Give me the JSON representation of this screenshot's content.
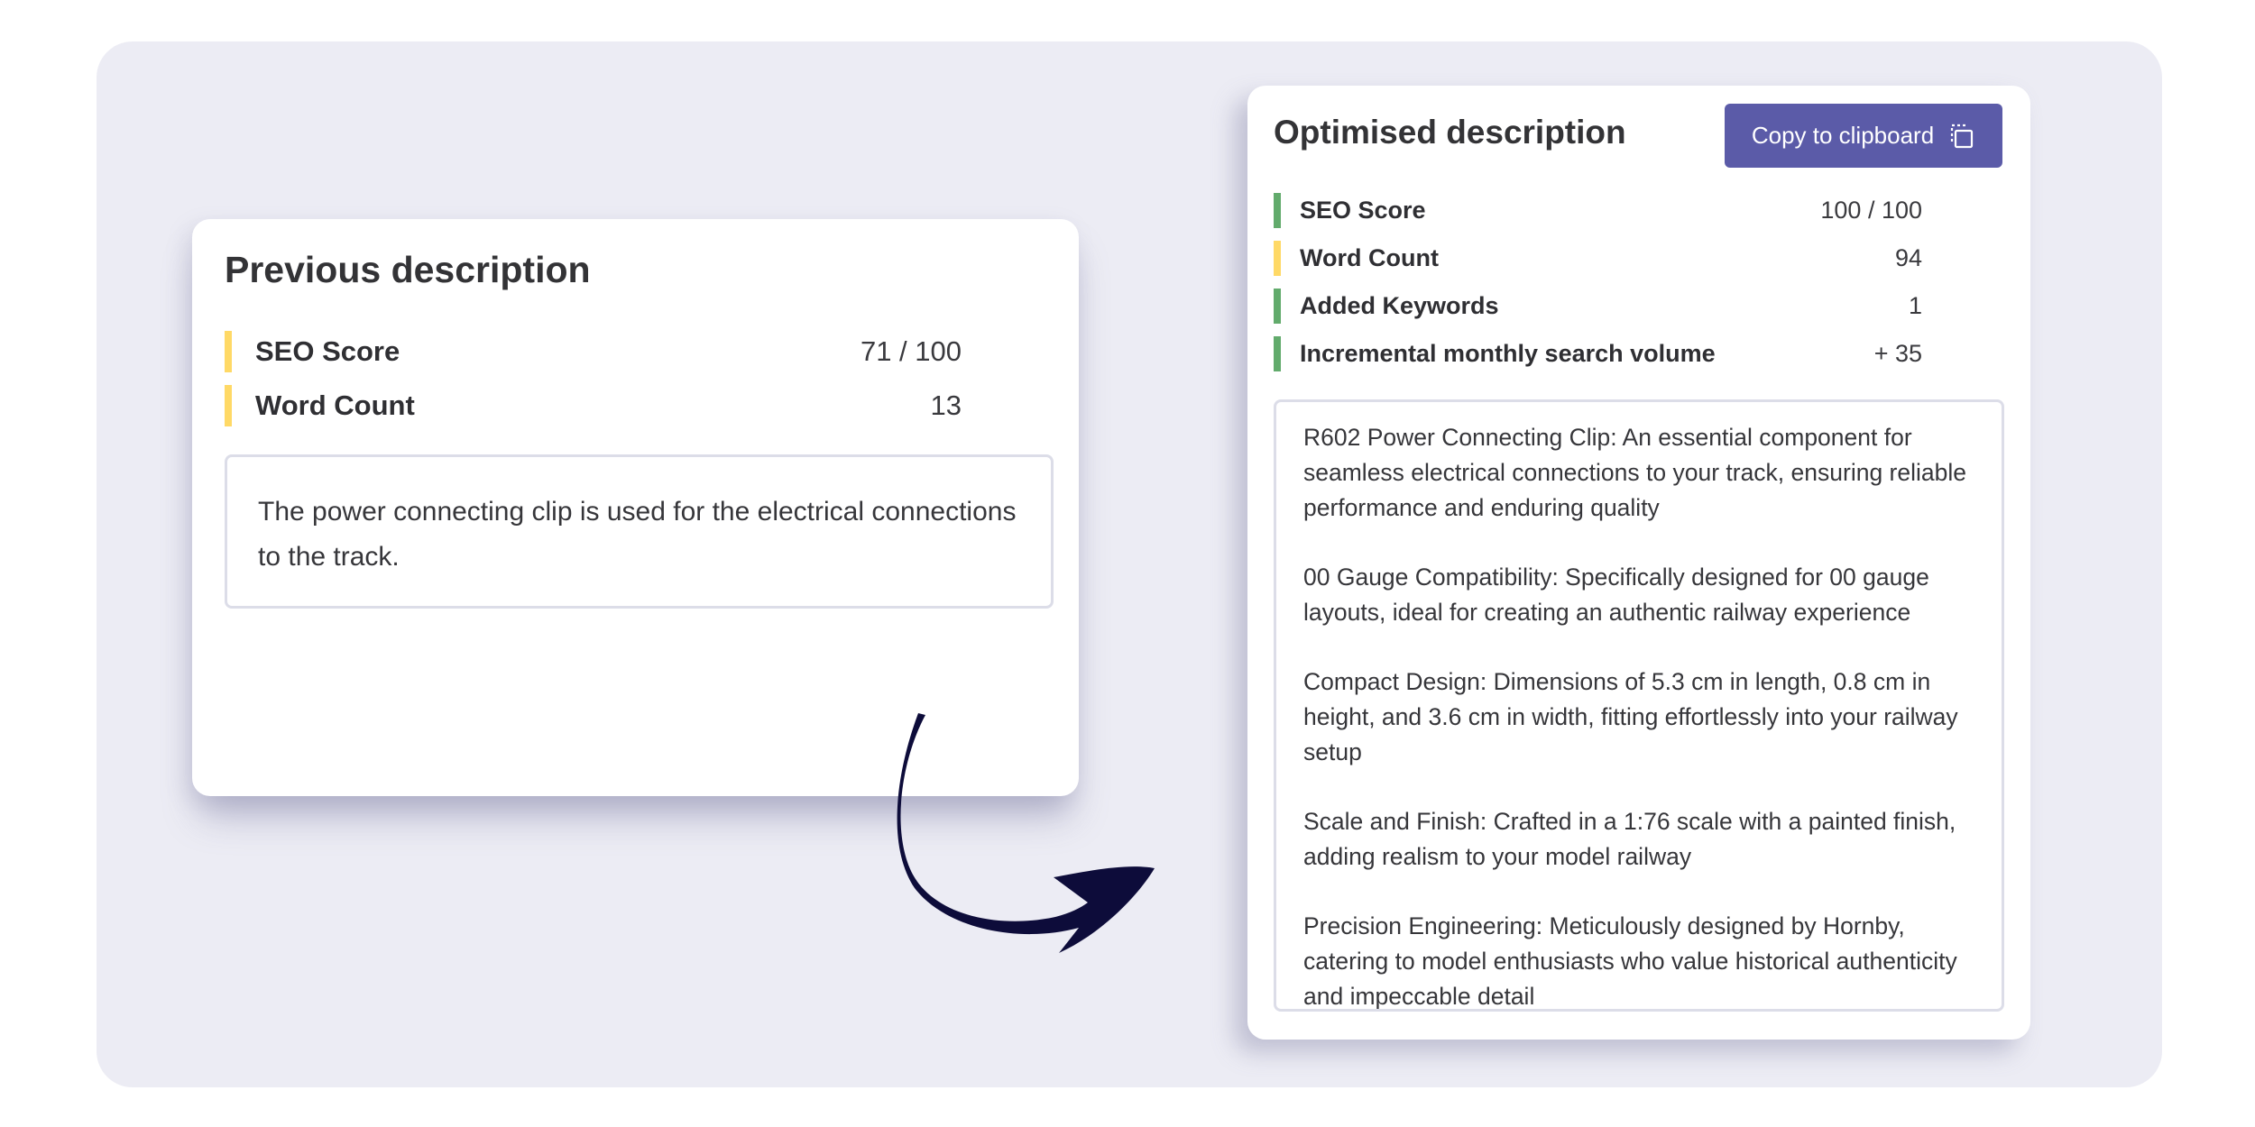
{
  "previous": {
    "title": "Previous description",
    "metrics": [
      {
        "label": "SEO Score",
        "value": "71 / 100",
        "color": "#ffd966"
      },
      {
        "label": "Word Count",
        "value": "13",
        "color": "#ffd966"
      }
    ],
    "description": "The power connecting clip is used for the electrical connections to the track."
  },
  "optimised": {
    "title": "Optimised description",
    "copy_label": "Copy to clipboard",
    "copy_icon": "clipboard-copy-icon",
    "metrics": [
      {
        "label": "SEO Score",
        "value": "100 / 100",
        "color": "#62ab6c"
      },
      {
        "label": "Word Count",
        "value": "94",
        "color": "#ffd966"
      },
      {
        "label": "Added Keywords",
        "value": "1",
        "color": "#62ab6c"
      },
      {
        "label": "Incremental monthly search volume",
        "value": "+ 35",
        "color": "#62ab6c"
      }
    ],
    "paragraphs": [
      "R602 Power Connecting Clip: An essential component for seamless electrical connections to your track, ensuring reliable performance and enduring quality",
      "00 Gauge Compatibility: Specifically designed for 00 gauge layouts, ideal for creating an authentic railway experience",
      "Compact Design: Dimensions of 5.3 cm in length, 0.8 cm in height, and 3.6 cm in width, fitting effortlessly into your railway setup",
      "Scale and Finish: Crafted in a 1:76 scale with a painted finish, adding realism to your model railway",
      "Precision Engineering: Meticulously designed by Hornby, catering to model enthusiasts who value historical authenticity and impeccable detail"
    ]
  },
  "colors": {
    "background": "#ececf4",
    "accent": "#5b5ba8",
    "arrow": "#0d0c3a"
  }
}
